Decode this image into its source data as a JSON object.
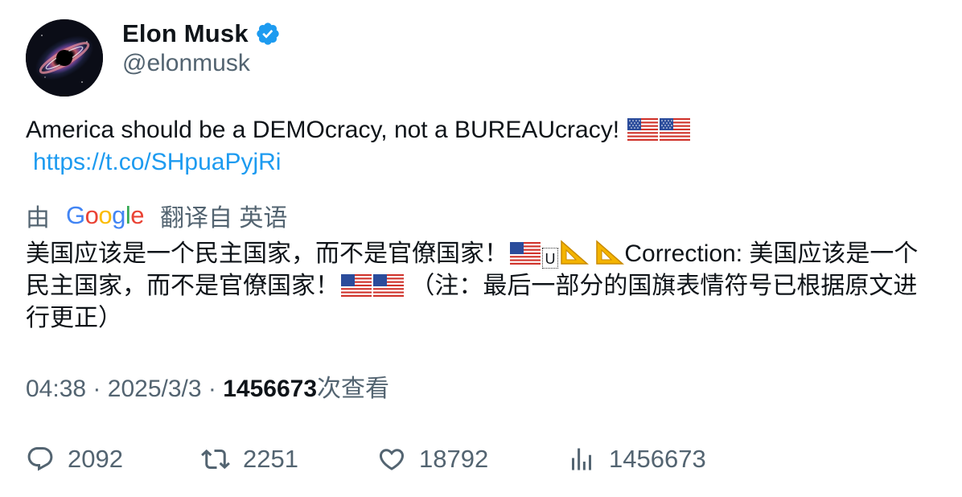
{
  "author": {
    "display_name": "Elon Musk",
    "handle": "@elonmusk",
    "verified": true,
    "avatar_icon": "galaxy-blackhole-avatar"
  },
  "tweet": {
    "text": "America should be a DEMOcracy, not a BUREAUcracy!",
    "link": "https://t.co/SHpuaPyjRi",
    "flags": [
      "us-flag-emoji",
      "us-flag-emoji"
    ]
  },
  "translation": {
    "by_label": "由",
    "provider": "Google",
    "from_label": "翻译自 英语",
    "text_part1": "美国应该是一个民主国家，而不是官僚国家！",
    "box_char": "U",
    "text_part2": "Correction: 美国应该是一个民主国家，而不是官僚国家！",
    "text_part3": "（注：最后一部分的国旗表情符号已根据原文进行更正）"
  },
  "meta": {
    "time": "04:38",
    "separator": "·",
    "date": "2025/3/3",
    "views": "1456673",
    "views_label": "次查看"
  },
  "actions": {
    "replies": "2092",
    "retweets": "2251",
    "likes": "18792",
    "views": "1456673"
  },
  "colors": {
    "text": "#0f1419",
    "secondary": "#536471",
    "link": "#1d9bf0",
    "verified": "#1d9bf0"
  }
}
